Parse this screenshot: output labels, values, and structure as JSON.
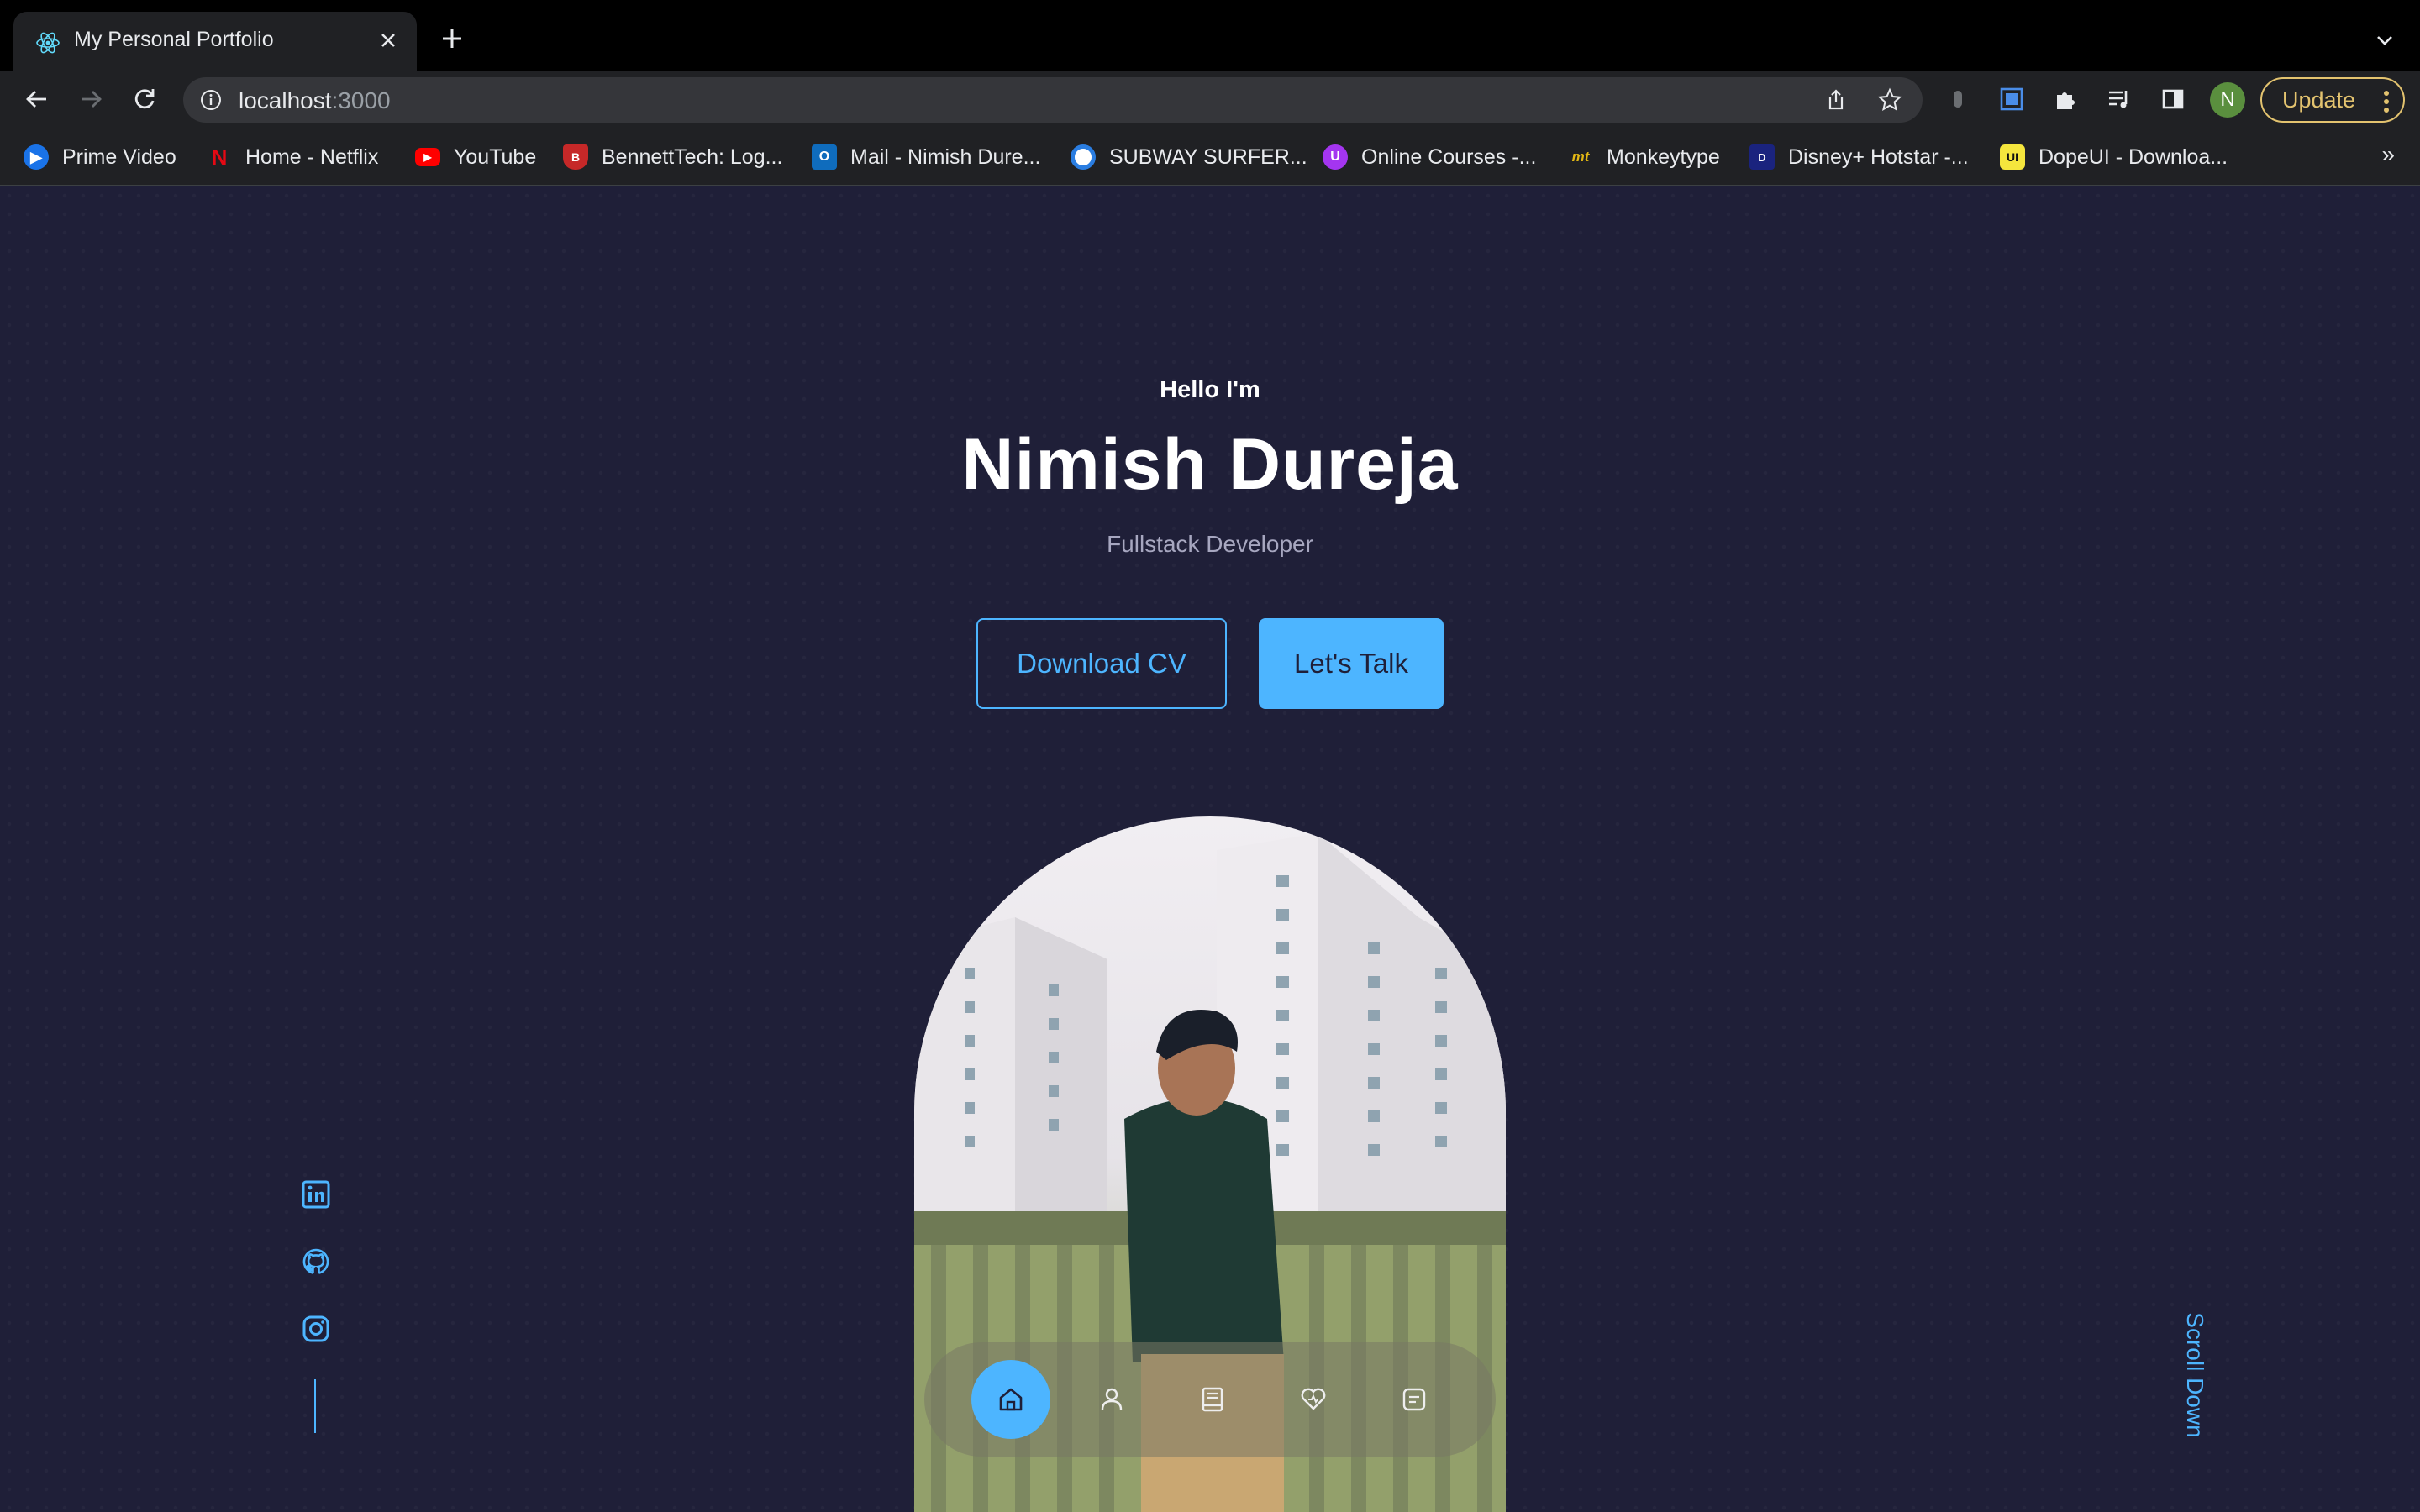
{
  "browser": {
    "tab_title": "My Personal Portfolio",
    "url_host": "localhost",
    "url_port": ":3000",
    "profile_initial": "N",
    "update_label": "Update"
  },
  "bookmarks": [
    {
      "label": "Prime Video",
      "icon": "prime-video-icon",
      "color": "#1a73e8"
    },
    {
      "label": "Home - Netflix",
      "icon": "netflix-icon",
      "color": "#e50914"
    },
    {
      "label": "YouTube",
      "icon": "youtube-icon",
      "color": "#ff0000"
    },
    {
      "label": "BennettTech: Log...",
      "icon": "bennett-icon",
      "color": "#c62828"
    },
    {
      "label": "Mail - Nimish Dure...",
      "icon": "outlook-icon",
      "color": "#0f6cbd"
    },
    {
      "label": "SUBWAY SURFER...",
      "icon": "subway-surfers-icon",
      "color": "#2a7de1"
    },
    {
      "label": "Online Courses -...",
      "icon": "udemy-icon",
      "color": "#a435f0"
    },
    {
      "label": "Monkeytype",
      "icon": "monkeytype-icon",
      "color": "#e2b714"
    },
    {
      "label": "Disney+ Hotstar -...",
      "icon": "hotstar-icon",
      "color": "#1a237e"
    },
    {
      "label": "DopeUI - Downloa...",
      "icon": "dopeui-icon",
      "color": "#f5e63d"
    }
  ],
  "hero": {
    "greeting": "Hello I'm",
    "name": "Nimish Dureja",
    "role": "Fullstack Developer",
    "download_cv": "Download CV",
    "lets_talk": "Let's Talk",
    "scroll_down": "Scroll Down"
  },
  "socials": [
    "linkedin-icon",
    "github-icon",
    "instagram-icon"
  ],
  "nav": [
    "home-icon",
    "user-icon",
    "book-icon",
    "services-icon",
    "message-icon"
  ],
  "colors": {
    "background": "#1f1f38",
    "accent": "#4db5ff",
    "muted_text": "#a7a7c0"
  }
}
